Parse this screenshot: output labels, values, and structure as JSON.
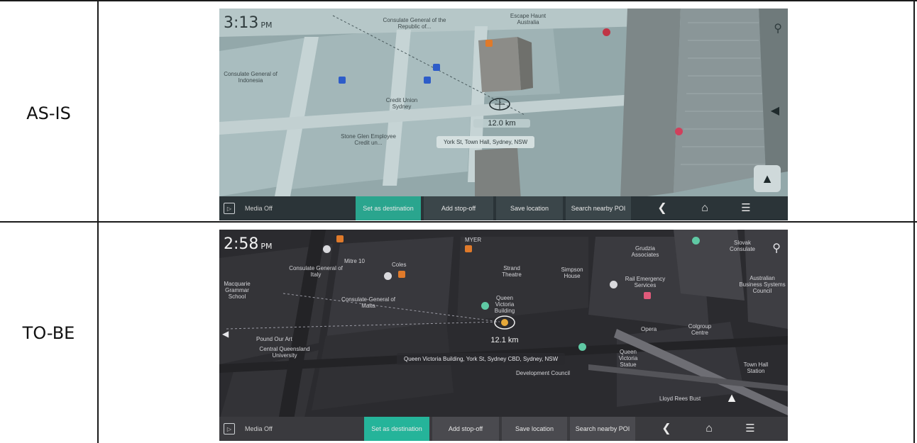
{
  "rows": [
    {
      "label": "AS-IS",
      "time": "3:13",
      "ampm": "PM",
      "distance": "12.0 km",
      "address": "York St, Town Hall, Sydney, NSW",
      "pois": [
        "Consulate General of the Republic of...",
        "Escape Haunt Australia",
        "Credit Union Sydney",
        "Stone Glen Employee Credit un...",
        "Consulate General of Indonesia"
      ],
      "media_label": "Media Off",
      "actions": {
        "set_destination": "Set as destination",
        "add_stop": "Add stop-off",
        "save_location": "Save location",
        "search_poi": "Search nearby POI"
      }
    },
    {
      "label": "TO-BE",
      "time": "2:58",
      "ampm": "PM",
      "distance": "12.1 km",
      "address": "Queen Victoria Building, York St, Sydney CBD, Sydney, NSW",
      "pois": [
        "Consulate General of Italy",
        "Mitre 10",
        "Coles",
        "MYER",
        "Strand Theatre",
        "Simpson House",
        "Rail Emergency Services",
        "Grudzia Associates",
        "Slovak Consulate",
        "Macquarie Grammar School",
        "Consulate-General of Malta",
        "Queen Victoria Building",
        "Pound Our Art",
        "Central Queensland University",
        "Development Council",
        "Queen Victoria Statue",
        "Australian Business Systems Council",
        "Lloyd Rees Bust",
        "Town Hall Station",
        "Colgroup Centre",
        "Opera"
      ],
      "media_label": "Media Off",
      "actions": {
        "set_destination": "Set as destination",
        "add_stop": "Add stop-off",
        "save_location": "Save location",
        "search_poi": "Search nearby POI"
      }
    }
  ],
  "colors": {
    "asis_map_bg": "#8fa3a6",
    "asis_bar": "#2b3438",
    "asis_accent": "#2aa58e",
    "tobe_map_bg": "#2c2c30",
    "tobe_bar": "#3a3a3e",
    "tobe_accent": "#25b49a"
  },
  "icons": {
    "media": "play-box-icon",
    "back": "chevron-left-icon",
    "home": "home-icon",
    "menu": "hamburger-menu-icon",
    "search": "search-icon",
    "compass": "navigation-arrow-icon",
    "volume": "speaker-icon"
  }
}
